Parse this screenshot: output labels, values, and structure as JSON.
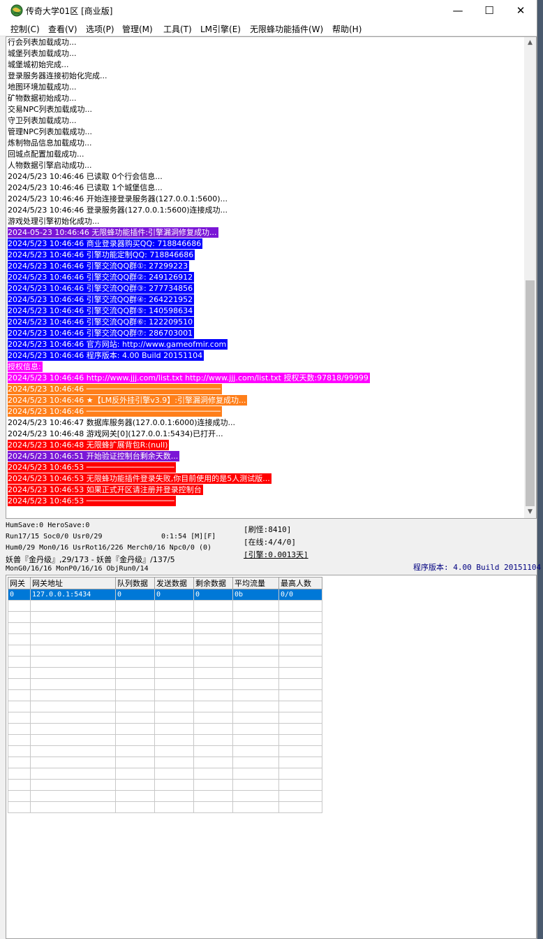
{
  "window": {
    "title": "传奇大学01区 [商业版]",
    "controls": {
      "minimize": "—",
      "maximize": "☐",
      "close": "✕"
    }
  },
  "menu": [
    "控制(C)",
    "查看(V)",
    "选项(P)",
    "管理(M)",
    "工具(T)",
    "LM引擎(E)",
    "无限蜂功能插件(W)",
    "帮助(H)"
  ],
  "colors": {
    "purple": "#7b16d6",
    "blue": "#0000ff",
    "magenta": "#ff00ff",
    "orange": "#ff7f1a",
    "red": "#ff0000",
    "selection": "#0078d7"
  },
  "log": [
    {
      "text": "行会列表加载成功...",
      "style": "plain"
    },
    {
      "text": "城堡列表加载成功...",
      "style": "plain"
    },
    {
      "text": "城堡城初始完成...",
      "style": "plain"
    },
    {
      "text": "登录服务器连接初始化完成...",
      "style": "plain"
    },
    {
      "text": "地图环境加载成功...",
      "style": "plain"
    },
    {
      "text": "矿物数据初始成功...",
      "style": "plain"
    },
    {
      "text": "交易NPC列表加载成功...",
      "style": "plain"
    },
    {
      "text": "守卫列表加载成功...",
      "style": "plain"
    },
    {
      "text": "管理NPC列表加载成功...",
      "style": "plain"
    },
    {
      "text": "炼制物品信息加载成功...",
      "style": "plain"
    },
    {
      "text": "回城点配置加载成功...",
      "style": "plain"
    },
    {
      "text": "人物数据引擎启动成功...",
      "style": "plain"
    },
    {
      "text": "2024/5/23 10:46:46 已读取 0个行会信息...",
      "style": "plain"
    },
    {
      "text": "2024/5/23 10:46:46 已读取 1个城堡信息...",
      "style": "plain"
    },
    {
      "text": "2024/5/23 10:46:46 开始连接登录服务器(127.0.0.1:5600)...",
      "style": "plain"
    },
    {
      "text": "2024/5/23 10:46:46 登录服务器(127.0.0.1:5600)连接成功...",
      "style": "plain"
    },
    {
      "text": "游戏处理引擎初始化成功...",
      "style": "plain"
    },
    {
      "text": "2024-05-23 10:46:46 无限蜂功能插件:引擎漏洞修复成功...",
      "style": "purple"
    },
    {
      "text": "2024/5/23 10:46:46 商业登录器购买QQ: 718846686",
      "style": "blue"
    },
    {
      "text": "2024/5/23 10:46:46 引擎功能定制QQ: 718846686",
      "style": "blue"
    },
    {
      "text": "2024/5/23 10:46:46 引擎交流QQ群①: 27299223",
      "style": "blue"
    },
    {
      "text": "2024/5/23 10:46:46 引擎交流QQ群②: 249126912",
      "style": "blue"
    },
    {
      "text": "2024/5/23 10:46:46 引擎交流QQ群③: 277734856",
      "style": "blue"
    },
    {
      "text": "2024/5/23 10:46:46 引擎交流QQ群④: 264221952",
      "style": "blue"
    },
    {
      "text": "2024/5/23 10:46:46 引擎交流QQ群⑤: 140598634",
      "style": "blue"
    },
    {
      "text": "2024/5/23 10:46:46 引擎交流QQ群⑥: 122209510",
      "style": "blue"
    },
    {
      "text": "2024/5/23 10:46:46 引擎交流QQ群⑦: 286703001",
      "style": "blue"
    },
    {
      "text": "2024/5/23 10:46:46 官方网站: http://www.gameofmir.com",
      "style": "blue"
    },
    {
      "text": "2024/5/23 10:46:46 程序版本: 4.00 Build 20151104",
      "style": "blue"
    },
    {
      "text": "授权信息:",
      "style": "magenta"
    },
    {
      "text": "2024/5/23 10:46:46 http://www.jjj.com/list.txt http://www.jjj.com/list.txt 授权天数:97818/99999",
      "style": "magenta"
    },
    {
      "text": "2024/5/23 10:46:46 ─────────────────────────────",
      "style": "orange"
    },
    {
      "text": "2024/5/23 10:46:46 ★【LM反外挂引擎v3.9】:引擎漏洞修复成功...",
      "style": "orange"
    },
    {
      "text": "2024/5/23 10:46:46 ─────────────────────────────",
      "style": "orange"
    },
    {
      "text": "2024/5/23 10:46:47 数据库服务器(127.0.0.1:6000)连接成功...",
      "style": "plain"
    },
    {
      "text": "2024/5/23 10:46:48 游戏网关[0](127.0.0.1:5434)已打开...",
      "style": "plain"
    },
    {
      "text": "2024/5/23 10:46:48 无限蜂扩展背包R:(null)",
      "style": "red"
    },
    {
      "text": "2024/5/23 10:46:51 开始验证控制台剩余天数...",
      "style": "purple"
    },
    {
      "text": "2024/5/23 10:46:53 ───────────────────",
      "style": "red"
    },
    {
      "text": "2024/5/23 10:46:53 无限蜂功能插件登录失败,你目前使用的是5人测试版...",
      "style": "red"
    },
    {
      "text": "2024/5/23 10:46:53 如果正式开区请注册并登录控制台",
      "style": "red"
    },
    {
      "text": "2024/5/23 10:46:53 ───────────────────",
      "style": "red"
    }
  ],
  "status": {
    "line1": "HumSave:0 HeroSave:0",
    "line2": "Run17/15 Soc0/0 Usr0/29",
    "time": "0:1:54 [M][F]",
    "line3": "Hum0/29 Mon0/16 UsrRot16/226 Merch0/16 Npc0/0 (0)",
    "line4": "妖兽『金丹级』,29/173 - 妖兽『金丹级』/137/5",
    "line5": "MonG0/16/16 MonP0/16/16 ObjRun0/14",
    "refresh": "[刷怪:8410]",
    "online": "[在线:4/4/0]",
    "engine": "[引擎:0.0013天]",
    "version": "程序版本: 4.00 Build 20151104"
  },
  "gateway_table": {
    "columns": [
      "网关",
      "网关地址",
      "队列数据",
      "发送数据",
      "剩余数据",
      "平均流量",
      "最高人数"
    ],
    "rows": [
      [
        "0",
        "127.0.0.1:5434",
        "0",
        "0",
        "0",
        "0b",
        "0/0"
      ]
    ],
    "empty_rows": 19
  }
}
